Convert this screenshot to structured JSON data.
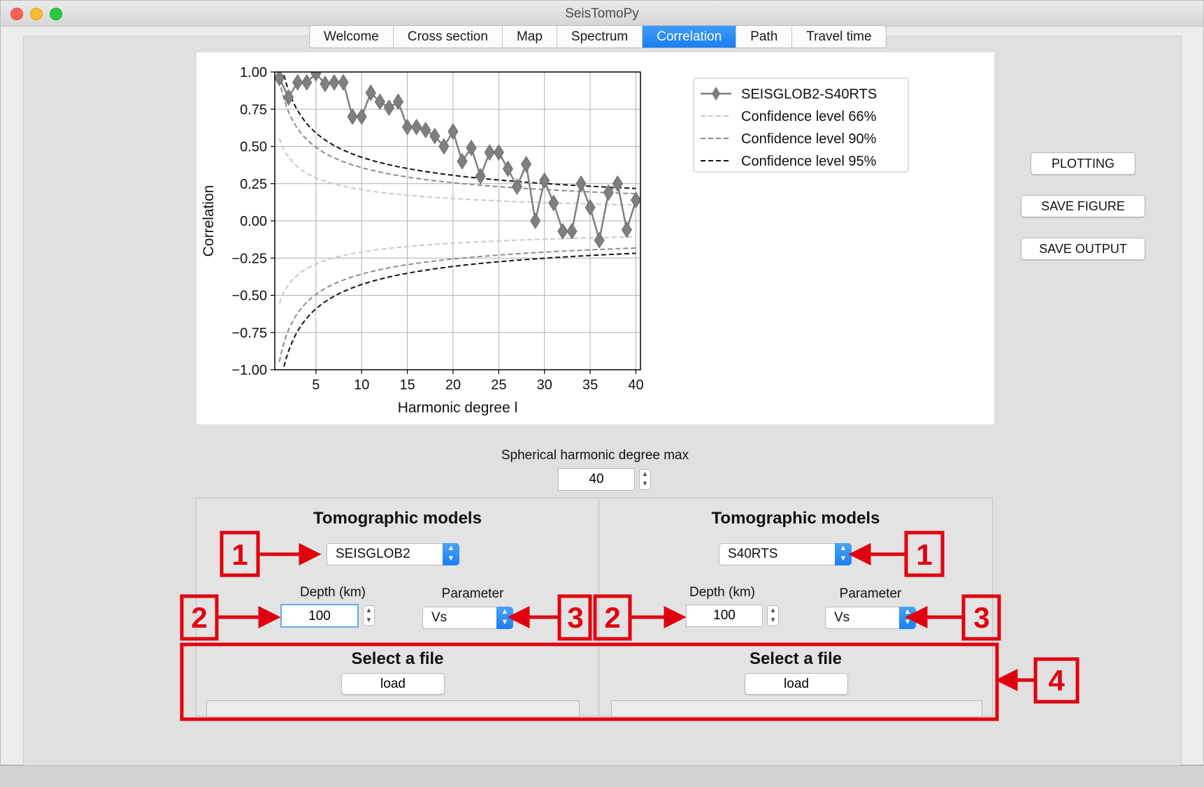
{
  "window": {
    "title": "SeisTomoPy"
  },
  "tabs": [
    "Welcome",
    "Cross section",
    "Map",
    "Spectrum",
    "Correlation",
    "Path",
    "Travel time"
  ],
  "active_tab": "Correlation",
  "buttons": {
    "plotting": "PLOTTING",
    "save_figure": "SAVE FIGURE",
    "save_output": "SAVE OUTPUT"
  },
  "degree_max": {
    "label": "Spherical harmonic degree max",
    "value": "40"
  },
  "left_panel": {
    "title": "Tomographic models",
    "model": "SEISGLOB2",
    "depth_label": "Depth (km)",
    "depth": "100",
    "param_label": "Parameter",
    "param": "Vs",
    "file_title": "Select a file",
    "load_label": "load"
  },
  "right_panel": {
    "title": "Tomographic models",
    "model": "S40RTS",
    "depth_label": "Depth (km)",
    "depth": "100",
    "param_label": "Parameter",
    "param": "Vs",
    "file_title": "Select a file",
    "load_label": "load"
  },
  "annotations": {
    "a1": "1",
    "a2": "2",
    "a3": "3",
    "a4": "4",
    "color": "#e0000f"
  },
  "chart_data": {
    "type": "line",
    "xlabel": "Harmonic degree l",
    "ylabel": "Correlation",
    "xlim": [
      0.5,
      40.5
    ],
    "ylim": [
      -1.0,
      1.0
    ],
    "xticks": [
      5,
      10,
      15,
      20,
      25,
      30,
      35,
      40
    ],
    "yticks": [
      1.0,
      0.75,
      0.5,
      0.25,
      0.0,
      -0.25,
      -0.5,
      -0.75,
      -1.0
    ],
    "ytick_labels": [
      "1.00",
      "0.75",
      "0.50",
      "0.25",
      "0.00",
      "−0.25",
      "−0.50",
      "−0.75",
      "−1.00"
    ],
    "grid": true,
    "legend_position": "outside-right",
    "series": [
      {
        "name": "SEISGLOB2-S40RTS",
        "style": "diamond-line",
        "color": "#7f7f7f",
        "x": [
          1,
          2,
          3,
          4,
          5,
          6,
          7,
          8,
          9,
          10,
          11,
          12,
          13,
          14,
          15,
          16,
          17,
          18,
          19,
          20,
          21,
          22,
          23,
          24,
          25,
          26,
          27,
          28,
          29,
          30,
          31,
          32,
          33,
          34,
          35,
          36,
          37,
          38,
          39,
          40
        ],
        "values": [
          0.96,
          0.83,
          0.93,
          0.93,
          0.99,
          0.92,
          0.93,
          0.93,
          0.7,
          0.7,
          0.86,
          0.8,
          0.76,
          0.8,
          0.63,
          0.63,
          0.61,
          0.57,
          0.5,
          0.6,
          0.4,
          0.49,
          0.3,
          0.46,
          0.46,
          0.35,
          0.23,
          0.38,
          0.0,
          0.27,
          0.12,
          -0.07,
          -0.07,
          0.25,
          0.09,
          -0.13,
          0.19,
          0.25,
          -0.06,
          0.14
        ]
      },
      {
        "name": "Confidence level 66%",
        "style": "dashed",
        "color": "#c8c8c8",
        "level": 0.96
      },
      {
        "name": "Confidence level 90%",
        "style": "dashed",
        "color": "#8c8c8c",
        "level": 1.64
      },
      {
        "name": "Confidence level 95%",
        "style": "dashed",
        "color": "#111111",
        "level": 1.96
      }
    ]
  }
}
